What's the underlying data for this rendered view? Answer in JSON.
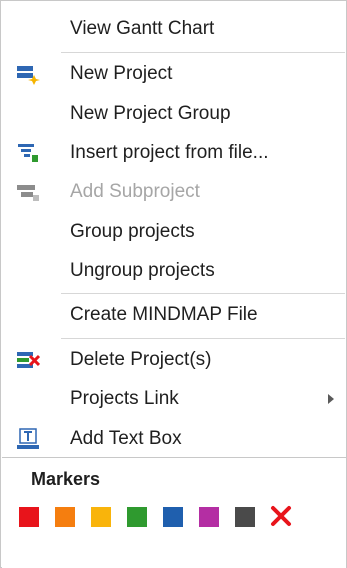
{
  "menu": {
    "items": [
      {
        "label": "View Gantt Chart",
        "icon": "none",
        "enabled": true
      },
      {
        "label": "New Project",
        "icon": "new-project-icon",
        "enabled": true
      },
      {
        "label": "New Project Group",
        "icon": "none",
        "enabled": true
      },
      {
        "label": "Insert project from file...",
        "icon": "insert-project-icon",
        "enabled": true
      },
      {
        "label": "Add Subproject",
        "icon": "add-subproject-icon",
        "enabled": false
      },
      {
        "label": "Group projects",
        "icon": "none",
        "enabled": true
      },
      {
        "label": "Ungroup projects",
        "icon": "none",
        "enabled": true
      },
      {
        "label": "Create MINDMAP File",
        "icon": "none",
        "enabled": true
      },
      {
        "label": "Delete Project(s)",
        "icon": "delete-project-icon",
        "enabled": true
      },
      {
        "label": "Projects Link",
        "icon": "none",
        "enabled": true,
        "submenu": true
      },
      {
        "label": "Add Text Box",
        "icon": "text-box-icon",
        "enabled": true
      }
    ]
  },
  "markers": {
    "title": "Markers",
    "colors": [
      {
        "name": "red",
        "hex": "#e8141b"
      },
      {
        "name": "orange",
        "hex": "#f57e0f"
      },
      {
        "name": "yellow",
        "hex": "#f9b40b"
      },
      {
        "name": "green",
        "hex": "#2f9a2f"
      },
      {
        "name": "blue",
        "hex": "#1f5fae"
      },
      {
        "name": "purple",
        "hex": "#b42ea3"
      },
      {
        "name": "dark-gray",
        "hex": "#4a4a4a"
      }
    ],
    "clear_icon": "red-x-icon",
    "clear_color": "#e8141b"
  }
}
